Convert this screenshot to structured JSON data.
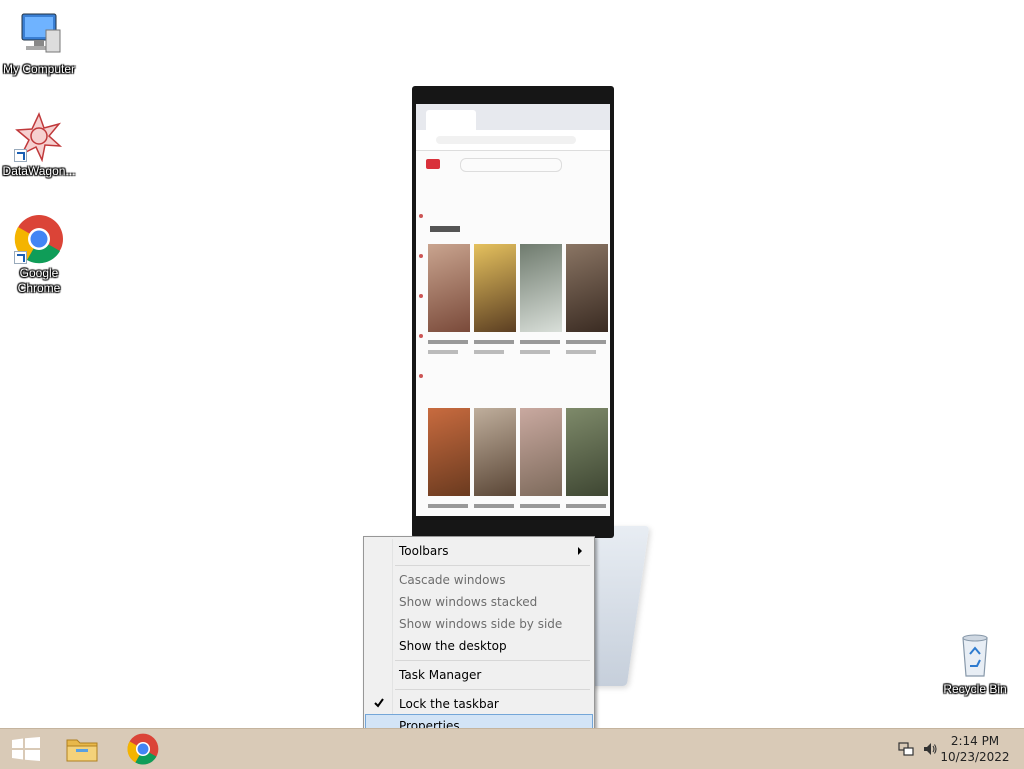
{
  "desktop": {
    "icons": [
      {
        "id": "my-computer",
        "label": "My Computer"
      },
      {
        "id": "datawagon",
        "label": "DataWagon..."
      },
      {
        "id": "google-chrome",
        "label": "Google Chrome"
      },
      {
        "id": "recycle-bin",
        "label": "Recycle Bin"
      }
    ]
  },
  "context_menu": {
    "items": [
      {
        "label": "Toolbars",
        "enabled": true,
        "submenu": true
      },
      {
        "label": "Cascade windows",
        "enabled": false
      },
      {
        "label": "Show windows stacked",
        "enabled": false
      },
      {
        "label": "Show windows side by side",
        "enabled": false
      },
      {
        "label": "Show the desktop",
        "enabled": true
      },
      {
        "label": "Task Manager",
        "enabled": true
      },
      {
        "label": "Lock the taskbar",
        "enabled": true,
        "checked": true
      },
      {
        "label": "Properties",
        "enabled": true,
        "highlighted": true
      }
    ]
  },
  "taskbar": {
    "buttons": [
      {
        "name": "start-button",
        "icon": "windows-logo-icon"
      },
      {
        "name": "file-explorer-button",
        "icon": "folder-icon"
      },
      {
        "name": "chrome-button",
        "icon": "chrome-icon"
      }
    ],
    "tray": {
      "icons": [
        "network-icon",
        "volume-icon"
      ],
      "time": "2:14 PM",
      "date": "10/23/2022"
    },
    "color": "#d9cab7"
  }
}
